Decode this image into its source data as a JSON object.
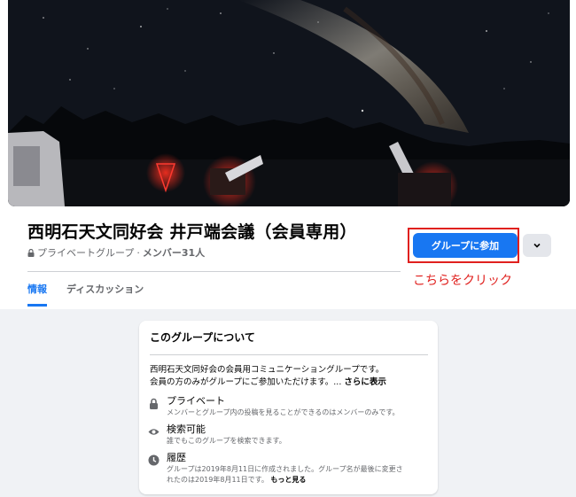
{
  "group": {
    "title": "西明石天文同好会 井戸端会議（会員専用）",
    "privacy": "プライベートグループ",
    "separator": "·",
    "members": "メンバー31人"
  },
  "actions": {
    "join_label": "グループに参加",
    "more_icon": "chevron-down-icon",
    "annotation": "こちらをクリック",
    "annotation_color": "#e0201e"
  },
  "tabs": [
    {
      "label": "情報",
      "active": true
    },
    {
      "label": "ディスカッション",
      "active": false
    }
  ],
  "about": {
    "title": "このグループについて",
    "description_line1": "西明石天文同好会の会員用コミュニケーショングループです。",
    "description_line2": "会員の方のみがグループにご参加いただけます。...",
    "see_more": "さらに表示",
    "items": [
      {
        "icon": "lock-icon",
        "title": "プライベート",
        "text": "メンバーとグループ内の投稿を見ることができるのはメンバーのみです。"
      },
      {
        "icon": "eye-icon",
        "title": "検索可能",
        "text": "誰でもこのグループを検索できます。"
      },
      {
        "icon": "clock-icon",
        "title": "履歴",
        "text": "グループは2019年8月11日に作成されました。グループ名が最後に変更さ",
        "text2": "れたのは2019年8月11日です。",
        "more": "もっと見る"
      }
    ]
  },
  "colors": {
    "accent": "#1877f2",
    "background": "#f0f2f5",
    "highlight": "#e0201e"
  }
}
